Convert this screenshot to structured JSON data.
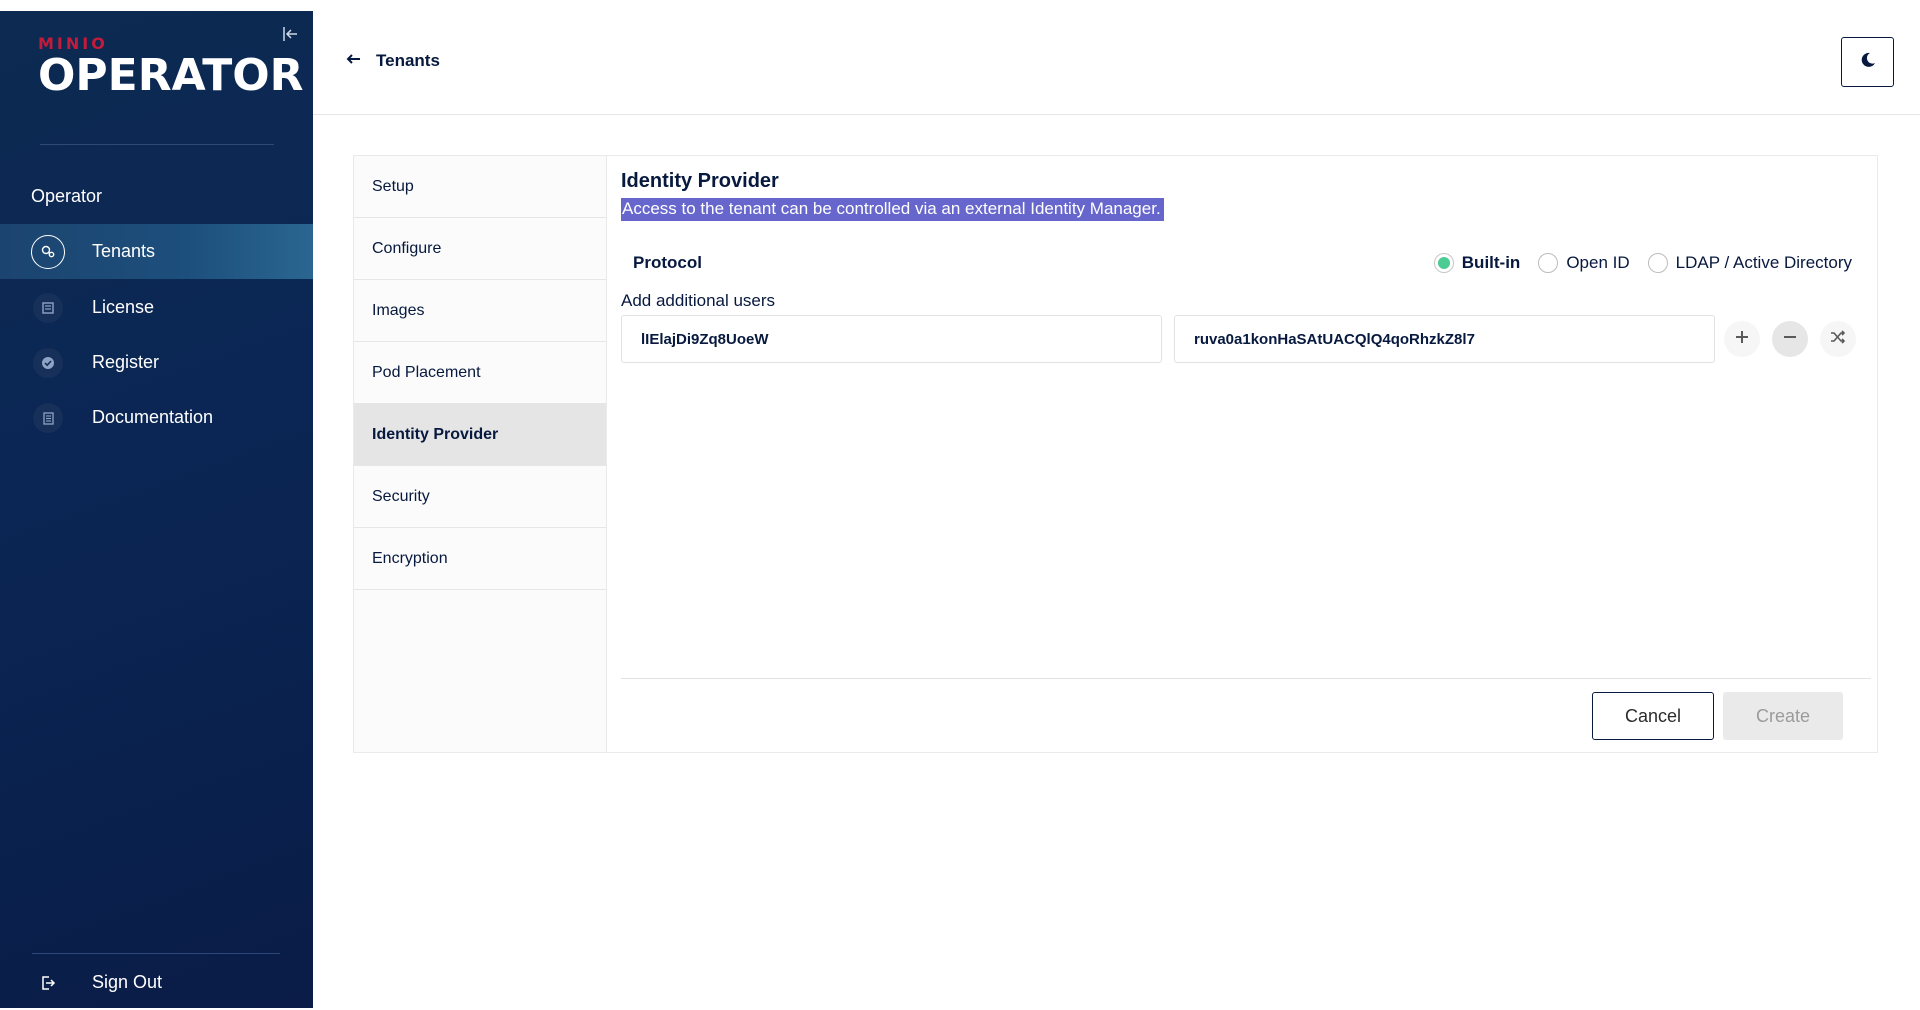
{
  "sidebar": {
    "brand_small": "MINIO",
    "brand_large": "OPERATOR",
    "section_title": "Operator",
    "items": [
      {
        "label": "Tenants",
        "icon": "tenants-icon",
        "active": true
      },
      {
        "label": "License",
        "icon": "license-icon"
      },
      {
        "label": "Register",
        "icon": "register-icon"
      },
      {
        "label": "Documentation",
        "icon": "documentation-icon"
      }
    ],
    "sign_out": "Sign Out"
  },
  "header": {
    "back_label": "Tenants"
  },
  "wizard": {
    "steps": [
      "Setup",
      "Configure",
      "Images",
      "Pod Placement",
      "Identity Provider",
      "Security",
      "Encryption"
    ],
    "active_step": "Identity Provider"
  },
  "panel": {
    "title": "Identity Provider",
    "description": "Access to the tenant can be controlled via an external Identity Manager.",
    "protocol_label": "Protocol",
    "protocol_options": [
      "Built-in",
      "Open ID",
      "LDAP / Active Directory"
    ],
    "protocol_selected": "Built-in",
    "add_users_label": "Add additional users",
    "access_key_value": "lIElajDi9Zq8UoeW",
    "secret_key_value": "ruva0a1konHaSAtUACQlQ4qoRhzkZ8l7"
  },
  "actions": {
    "cancel": "Cancel",
    "create": "Create"
  },
  "colors": {
    "sidebar_bg": "#0b2654",
    "accent_red": "#c51b3b",
    "radio_green": "#4ccb92",
    "highlight": "#6666cc"
  }
}
